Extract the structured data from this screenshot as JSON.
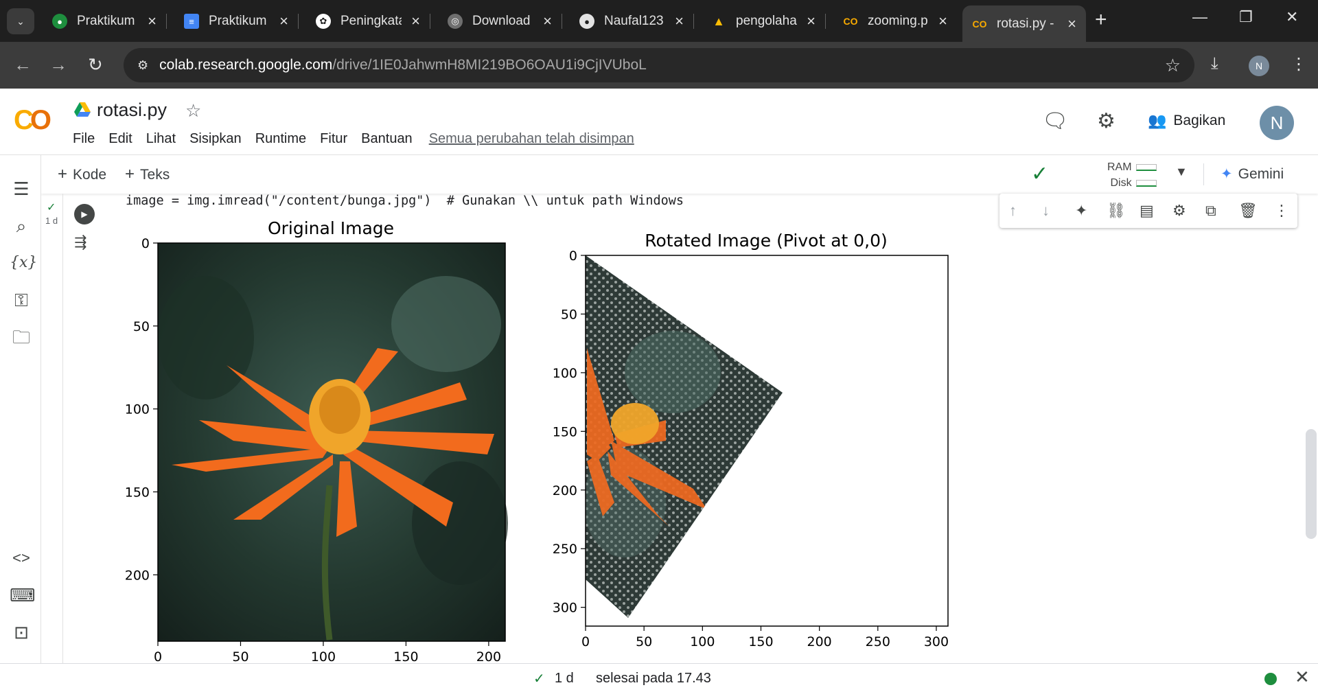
{
  "browser": {
    "tabs": [
      {
        "label": "Praktikum",
        "favicon": "colab-green-icon",
        "color": "#1e8e3e"
      },
      {
        "label": "Praktikum",
        "favicon": "docs-icon",
        "color": "#4285f4"
      },
      {
        "label": "Peningkata",
        "favicon": "chatgpt-icon",
        "color": "#ffffff"
      },
      {
        "label": "Download",
        "favicon": "globe-icon",
        "color": "#9aa0a6"
      },
      {
        "label": "Naufal123",
        "favicon": "github-icon",
        "color": "#e3e3e3"
      },
      {
        "label": "pengolaha",
        "favicon": "drive-icon",
        "color": "#fbbc04"
      },
      {
        "label": "zooming.p",
        "favicon": "colab-icon",
        "color": "#f9ab00"
      },
      {
        "label": "rotasi.py -",
        "favicon": "colab-icon",
        "color": "#f9ab00"
      }
    ],
    "url_host": "colab.research.google.com",
    "url_path": "/drive/1IE0JahwmH8MI219BO6OAU1i9CjIVUboL",
    "profile_initial": "N"
  },
  "colab": {
    "logo": "CO",
    "title": "rotasi.py",
    "menu": [
      "File",
      "Edit",
      "Lihat",
      "Sisipkan",
      "Runtime",
      "Fitur",
      "Bantuan"
    ],
    "saved_status": "Semua perubahan telah disimpan",
    "share_label": "Bagikan",
    "avatar_initial": "N",
    "add_code": "Kode",
    "add_text": "Teks",
    "ram_label": "RAM",
    "disk_label": "Disk",
    "gemini_label": "Gemini"
  },
  "cell": {
    "exec_time": "1 d",
    "code_line": "image = img.imread(\"/content/bunga.jpg\")  # Gunakan \\\\ untuk path Windows"
  },
  "figure": {
    "left_title": "Original Image",
    "right_title": "Rotated Image (Pivot at 0,0)",
    "left_xticks": [
      "0",
      "50",
      "100",
      "150",
      "200"
    ],
    "left_yticks": [
      "0",
      "50",
      "100",
      "150",
      "200"
    ],
    "right_xticks": [
      "0",
      "50",
      "100",
      "150",
      "200",
      "250",
      "300"
    ],
    "right_yticks": [
      "0",
      "50",
      "100",
      "150",
      "200",
      "250",
      "300"
    ]
  },
  "chart_data": [
    {
      "type": "image",
      "title": "Original Image",
      "xlim": [
        0,
        210
      ],
      "ylim": [
        240,
        0
      ],
      "xticks": [
        0,
        50,
        100,
        150,
        200
      ],
      "yticks": [
        0,
        50,
        100,
        150,
        200
      ]
    },
    {
      "type": "image",
      "title": "Rotated Image (Pivot at 0,0)",
      "xlim": [
        0,
        310
      ],
      "ylim": [
        316,
        0
      ],
      "xticks": [
        0,
        50,
        100,
        150,
        200,
        250,
        300
      ],
      "yticks": [
        0,
        50,
        100,
        150,
        200,
        250,
        300
      ]
    }
  ],
  "status": {
    "time": "1 d",
    "message": "selesai pada 17.43"
  }
}
